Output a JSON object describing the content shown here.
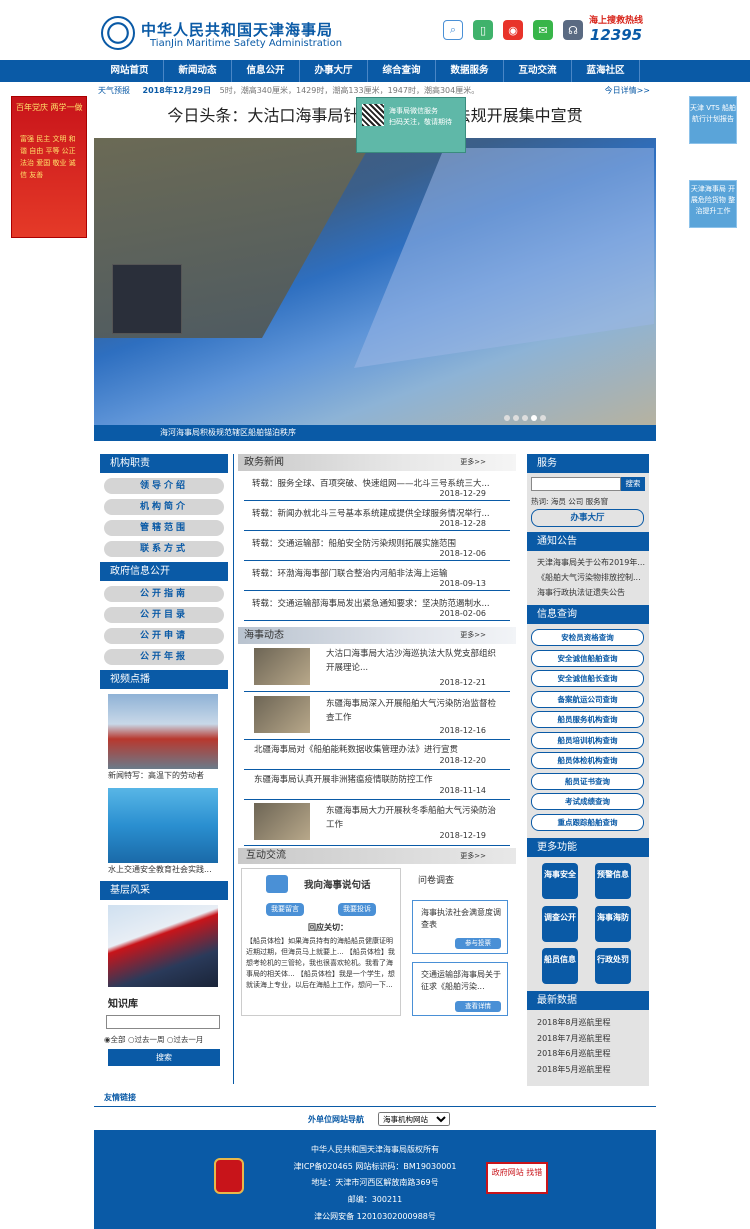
{
  "header": {
    "org_cn": "中华人民共和国天津海事局",
    "org_en": "TianJin Maritime Safety Administration",
    "hotline_title": "海上搜救热线",
    "hotline_number": "12395"
  },
  "nav": [
    "网站首页",
    "新闻动态",
    "信息公开",
    "办事大厅",
    "综合查询",
    "数据服务",
    "互动交流",
    "蓝海社区"
  ],
  "weather": {
    "label": "天气预报",
    "date": "2018年12月29日",
    "text": "5时，潮高340厘米，1429时，潮高133厘米，1947时，潮高304厘米。",
    "more": "今日详情>>"
  },
  "headline": "今日头条：大沽口海事局针对近期...法律法规开展集中宣贯",
  "popup": {
    "line1": "海事局微信服务",
    "line2": "扫码关注，敬请期待"
  },
  "hero": {
    "caption": "海河海事局积极规范辖区船舶锚泊秩序"
  },
  "left_ad": {
    "title": "百年党庆 两学一做",
    "body": "富强 民主 文明 和谐 自由 平等 公正 法治 爱国 敬业 诚信 友善"
  },
  "right_ads": [
    "天津 VTS 船舶航行计划报告",
    "天津海事局 开展危险货物 整治提升工作"
  ],
  "left": {
    "org_title": "机构职责",
    "org_items": [
      "领导介绍",
      "机构简介",
      "管辖范围",
      "联系方式"
    ],
    "gov_title": "政府信息公开",
    "gov_items": [
      "公开指南",
      "公开目录",
      "公开申请",
      "公开年报"
    ],
    "video_title": "视频点播",
    "videos": [
      "新闻特写：高温下的劳动者",
      "水上交通安全教育社会实践..."
    ],
    "base_title": "基层风采",
    "kb_title": "知识库",
    "kb_radios": [
      "全部",
      "过去一周",
      "过去一月"
    ],
    "kb_button": "搜索"
  },
  "gov_news": {
    "title": "政务新闻",
    "more": "更多>>",
    "items": [
      {
        "t": "转载：服务全球、百项突破、快速组网——北斗三号系统三大...",
        "d": "2018-12-29"
      },
      {
        "t": "转载：新闻办就北斗三号基本系统建成提供全球服务情况举行...",
        "d": "2018-12-28"
      },
      {
        "t": "转载：交通运输部：船舶安全防污染规则拓展实施范围",
        "d": "2018-12-06"
      },
      {
        "t": "转载：环渤海海事部门联合整治内河船非法海上运输",
        "d": "2018-09-13"
      },
      {
        "t": "转载：交通运输部海事局发出紧急通知要求：坚决防范遏制水...",
        "d": "2018-02-06"
      }
    ]
  },
  "maritime": {
    "title": "海事动态",
    "more": "更多>>",
    "items": [
      {
        "t": "大沽口海事局大沽沙海巡执法大队党支部组织开展理论...",
        "d": "2018-12-21"
      },
      {
        "t": "东疆海事局深入开展船舶大气污染防治监督检查工作",
        "d": "2018-12-16"
      },
      {
        "t": "北疆海事局对《船舶能耗数据收集管理办法》进行宣贯",
        "d": "2018-12-20"
      },
      {
        "t": "东疆海事局认真开展非洲猪瘟疫情联防防控工作",
        "d": "2018-11-14"
      },
      {
        "t": "东疆海事局大力开展秋冬季船舶大气污染防治工作",
        "d": "2018-12-19"
      }
    ]
  },
  "interact": {
    "title": "互动交流",
    "more": "更多>>",
    "say_title": "我向海事说句话",
    "btn_msg": "我要留言",
    "btn_complain": "我要投诉",
    "reply_title": "回应关切：",
    "reply_text": "【船员体检】如果海员持有的海船船员健康证明近期过期，但海员马上就要上... 【船员体检】我想考轮机的三管轮，我也很喜欢轮机。我看了海事局的相关体... 【船员体检】我是一个学生，想就读海上专业，以后在海船上工作，想问一下...",
    "survey_title": "问卷调查",
    "surveys": [
      {
        "t": "海事执法社会满意度调查表",
        "b": "参与投票"
      },
      {
        "t": "交通运输部海事局关于征求《船舶污染...",
        "b": "查看详情"
      }
    ]
  },
  "right": {
    "service_title": "服务",
    "search_btn": "搜索",
    "hot": "热词: 海员 公司 服务窗",
    "hall": "办事大厅",
    "notice_title": "通知公告",
    "notices": [
      "天津海事局关于公布2019年...",
      "《船舶大气污染物排放控制...",
      "海事行政执法证遗失公告"
    ],
    "query_title": "信息查询",
    "queries": [
      "安检员资格查询",
      "安全诚信船舶查询",
      "安全诚信船长查询",
      "备案航运公司查询",
      "船员服务机构查询",
      "船员培训机构查询",
      "船员体检机构查询",
      "船员证书查询",
      "考试成绩查询",
      "重点跟踪船舶查询"
    ],
    "more_title": "更多功能",
    "functions": [
      "海事安全",
      "预警信息",
      "调查公开",
      "海事海防",
      "船员信息",
      "行政处罚"
    ],
    "data_title": "最新数据",
    "data": [
      "2018年8月巡航里程",
      "2018年7月巡航里程",
      "2018年6月巡航里程",
      "2018年5月巡航里程"
    ]
  },
  "footer": {
    "links_label": "友情链接",
    "nav_label": "外单位网站导航",
    "select_value": "海事机构网站",
    "lines": [
      "中华人民共和国天津海事局版权所有",
      "津ICP备020465 网站标识码：BM19030001",
      "地址：天津市河西区解放南路369号",
      "邮编：300211",
      "津公网安备 12010302000988号"
    ],
    "badge_text": "政府网站 找错"
  }
}
